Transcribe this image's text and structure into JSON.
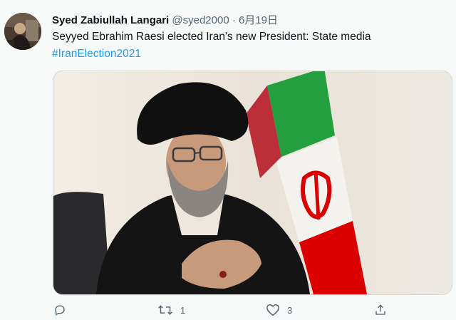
{
  "tweet": {
    "author_name": "Syed Zabiullah Langari",
    "handle": "@syed2000",
    "separator": "·",
    "date": "6月19日",
    "text": "Seyyed Ebrahim Raesi elected Iran's new President: State media",
    "hashtag": "#IranElection2021"
  },
  "actions": {
    "reply_icon": "reply-icon",
    "retweet_icon": "retweet-icon",
    "retweet_count": "1",
    "like_icon": "heart-icon",
    "like_count": "3",
    "share_icon": "share-icon"
  },
  "colors": {
    "background": "#f7f9f9",
    "link": "#1d9bf0",
    "muted": "#536471",
    "flag_green": "#239f40",
    "flag_red": "#da0000"
  }
}
